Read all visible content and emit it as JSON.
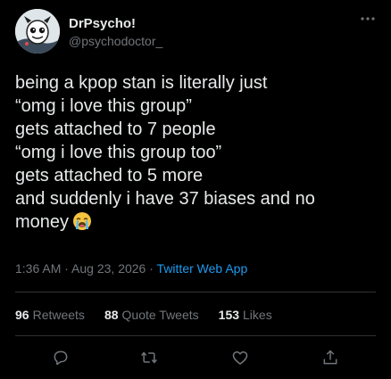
{
  "author": {
    "display_name": "DrPsycho!",
    "handle": "@psychodoctor_"
  },
  "tweet": {
    "lines": [
      "being a kpop stan is literally just",
      "“omg i love this group”",
      "gets attached to 7 people",
      "“omg i love this group too”",
      "gets attached to 5 more",
      "and suddenly i have 37 biases and no",
      "money"
    ],
    "emoji": "loudly-crying-face"
  },
  "meta": {
    "time": "1:36 AM",
    "separator": " · ",
    "date": "Aug 23, 2026",
    "source": "Twitter Web App"
  },
  "stats": {
    "retweets_count": "96",
    "retweets_label": "Retweets",
    "quotes_count": "88",
    "quotes_label": "Quote Tweets",
    "likes_count": "153",
    "likes_label": "Likes"
  },
  "colors": {
    "background": "#000000",
    "text": "#e7e9ea",
    "secondary": "#71767b",
    "link": "#1d9bf0",
    "divider": "#2f3336"
  },
  "icons": {
    "more": "more-horizontal-icon",
    "reply": "reply-icon",
    "retweet": "retweet-icon",
    "like": "heart-icon",
    "share": "share-icon"
  }
}
